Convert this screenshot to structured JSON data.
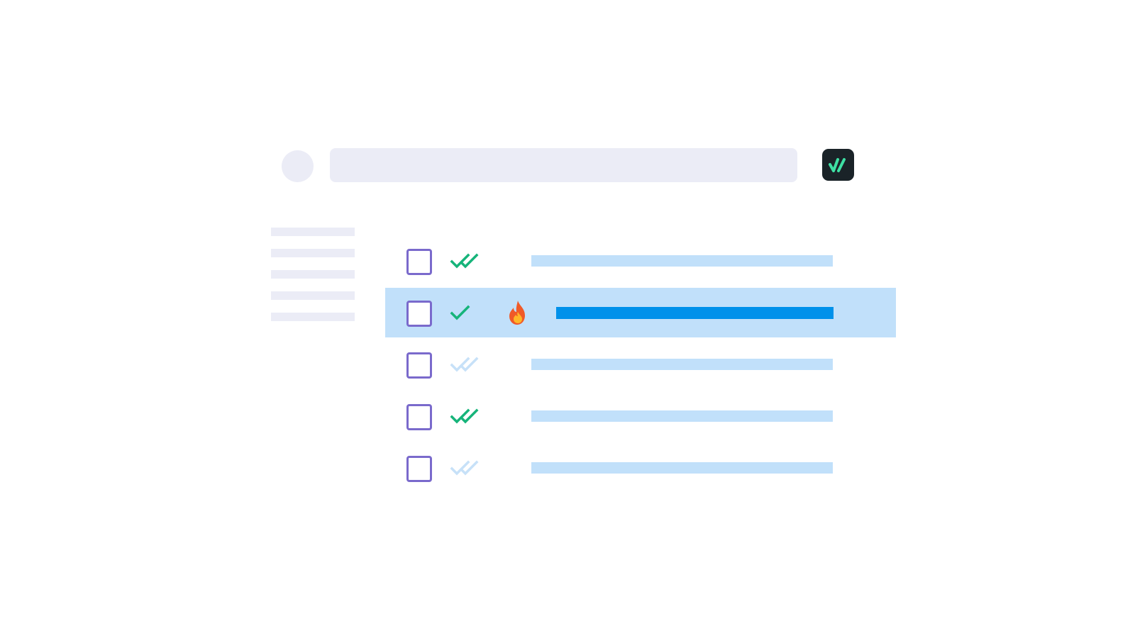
{
  "colors": {
    "background": "#ffffff",
    "placeholder": "#ebecf6",
    "checkbox_border": "#7a6acc",
    "status_green": "#16b47a",
    "status_muted": "#c7e1f8",
    "row_highlight": "#c1e0fa",
    "subject_placeholder": "#c1e0fa",
    "subject_selected": "#0091ea",
    "logo_bg": "#1a2328",
    "logo_mark": "#3ee0a4"
  },
  "header": {
    "avatar_icon": "avatar-placeholder",
    "search_icon": "search-bar-placeholder",
    "logo_icon": "double-check-logo"
  },
  "sidebar": {
    "items": [
      {
        "icon": "text-line-placeholder"
      },
      {
        "icon": "text-line-placeholder"
      },
      {
        "icon": "text-line-placeholder"
      },
      {
        "icon": "text-line-placeholder"
      },
      {
        "icon": "text-line-placeholder"
      }
    ]
  },
  "list": {
    "rows": [
      {
        "checked": false,
        "status": "read",
        "status_icon": "double-check-icon",
        "hot": false,
        "selected": false
      },
      {
        "checked": false,
        "status": "delivered",
        "status_icon": "single-check-icon",
        "hot": true,
        "hot_icon": "fire-icon",
        "selected": true
      },
      {
        "checked": false,
        "status": "pending",
        "status_icon": "double-check-muted-icon",
        "hot": false,
        "selected": false
      },
      {
        "checked": false,
        "status": "read",
        "status_icon": "double-check-icon",
        "hot": false,
        "selected": false
      },
      {
        "checked": false,
        "status": "pending",
        "status_icon": "double-check-muted-icon",
        "hot": false,
        "selected": false
      }
    ]
  }
}
